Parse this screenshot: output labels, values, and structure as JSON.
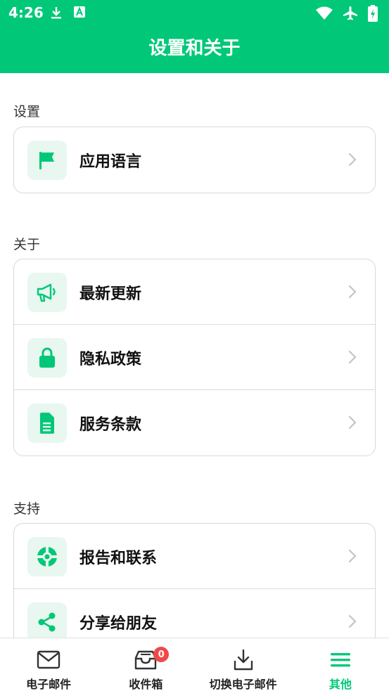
{
  "status_bar": {
    "time": "4:26",
    "icons_left": [
      "download-icon",
      "app-notification-icon"
    ],
    "icons_right": [
      "wifi-icon",
      "airplane-icon",
      "battery-charging-icon"
    ]
  },
  "header": {
    "title": "设置和关于"
  },
  "colors": {
    "accent": "#00c878",
    "icon_bg": "#e8f7ef",
    "badge": "#f04848",
    "divider": "#dcdcdc"
  },
  "sections": [
    {
      "label": "设置",
      "items": [
        {
          "label": "应用语言",
          "icon": "flag-icon"
        }
      ]
    },
    {
      "label": "关于",
      "items": [
        {
          "label": "最新更新",
          "icon": "megaphone-icon"
        },
        {
          "label": "隐私政策",
          "icon": "lock-icon"
        },
        {
          "label": "服务条款",
          "icon": "document-icon"
        }
      ]
    },
    {
      "label": "支持",
      "items": [
        {
          "label": "报告和联系",
          "icon": "lifebuoy-icon"
        },
        {
          "label": "分享给朋友",
          "icon": "share-icon"
        }
      ]
    }
  ],
  "bottom_nav": {
    "items": [
      {
        "label": "电子邮件",
        "icon": "mail-icon"
      },
      {
        "label": "收件箱",
        "icon": "inbox-icon",
        "badge": "0"
      },
      {
        "label": "切换电子邮件",
        "icon": "download-tray-icon"
      },
      {
        "label": "其他",
        "icon": "menu-icon",
        "active": true
      }
    ]
  }
}
